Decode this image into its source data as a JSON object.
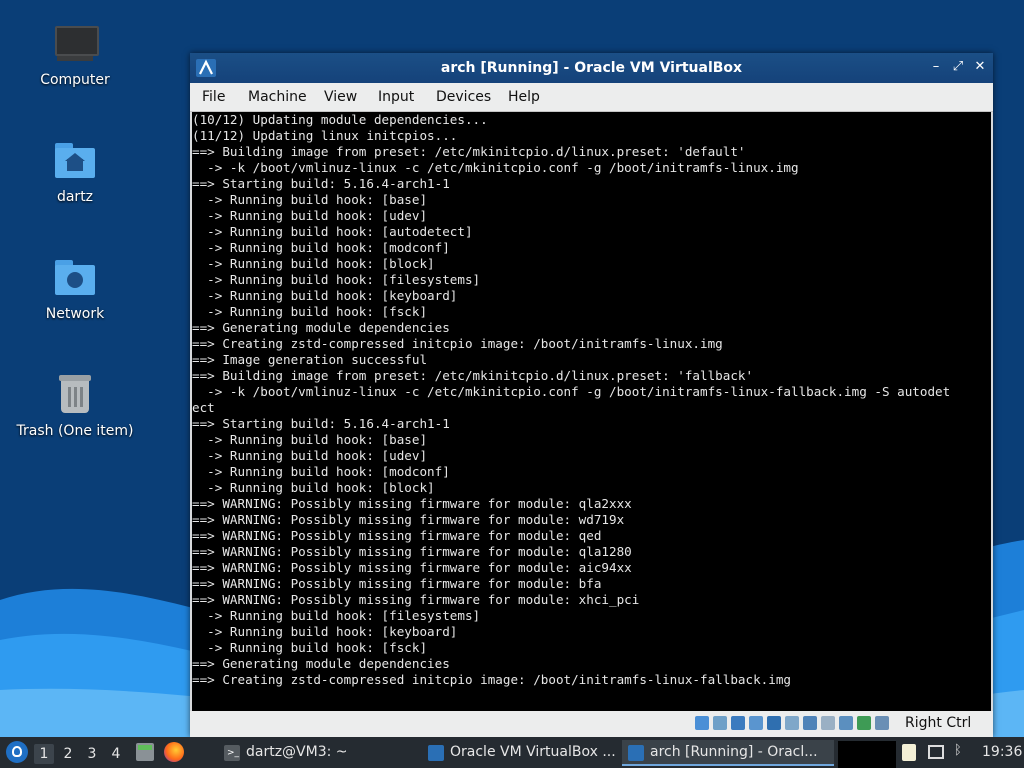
{
  "desktop": {
    "icons": [
      {
        "label": "Computer",
        "icon": "computer-icon"
      },
      {
        "label": "dartz",
        "icon": "home-folder-icon"
      },
      {
        "label": "Network",
        "icon": "network-folder-icon"
      },
      {
        "label": "Trash (One item)",
        "icon": "trash-icon"
      }
    ]
  },
  "window": {
    "title": "arch [Running] - Oracle VM VirtualBox",
    "controls": {
      "minimize": "–",
      "restore": "⤢",
      "close": "✕"
    },
    "menu": [
      "File",
      "Machine",
      "View",
      "Input",
      "Devices",
      "Help"
    ],
    "console_lines": [
      "(10/12) Updating module dependencies...",
      "(11/12) Updating linux initcpios...",
      "==> Building image from preset: /etc/mkinitcpio.d/linux.preset: 'default'",
      "  -> -k /boot/vmlinuz-linux -c /etc/mkinitcpio.conf -g /boot/initramfs-linux.img",
      "==> Starting build: 5.16.4-arch1-1",
      "  -> Running build hook: [base]",
      "  -> Running build hook: [udev]",
      "  -> Running build hook: [autodetect]",
      "  -> Running build hook: [modconf]",
      "  -> Running build hook: [block]",
      "  -> Running build hook: [filesystems]",
      "  -> Running build hook: [keyboard]",
      "  -> Running build hook: [fsck]",
      "==> Generating module dependencies",
      "==> Creating zstd-compressed initcpio image: /boot/initramfs-linux.img",
      "==> Image generation successful",
      "==> Building image from preset: /etc/mkinitcpio.d/linux.preset: 'fallback'",
      "  -> -k /boot/vmlinuz-linux -c /etc/mkinitcpio.conf -g /boot/initramfs-linux-fallback.img -S autodet",
      "ect",
      "==> Starting build: 5.16.4-arch1-1",
      "  -> Running build hook: [base]",
      "  -> Running build hook: [udev]",
      "  -> Running build hook: [modconf]",
      "  -> Running build hook: [block]",
      "==> WARNING: Possibly missing firmware for module: qla2xxx",
      "==> WARNING: Possibly missing firmware for module: wd719x",
      "==> WARNING: Possibly missing firmware for module: qed",
      "==> WARNING: Possibly missing firmware for module: qla1280",
      "==> WARNING: Possibly missing firmware for module: aic94xx",
      "==> WARNING: Possibly missing firmware for module: bfa",
      "==> WARNING: Possibly missing firmware for module: xhci_pci",
      "  -> Running build hook: [filesystems]",
      "  -> Running build hook: [keyboard]",
      "  -> Running build hook: [fsck]",
      "==> Generating module dependencies",
      "==> Creating zstd-compressed initcpio image: /boot/initramfs-linux-fallback.img"
    ],
    "status_icons": [
      "hard-disk-icon",
      "optical-drive-icon",
      "audio-icon",
      "network-icon",
      "usb-icon",
      "shared-folder-icon",
      "display-icon",
      "video-capture-icon",
      "cpu-icon",
      "mouse-integration-icon",
      "keyboard-icon"
    ],
    "host_key": "Right Ctrl"
  },
  "taskbar": {
    "workspaces": [
      "1",
      "2",
      "3",
      "4"
    ],
    "active_workspace": "1",
    "tasks": [
      {
        "label": "dartz@VM3: ~",
        "icon": "terminal-icon"
      },
      {
        "label": "Oracle VM VirtualBox ...",
        "icon": "virtualbox-icon"
      },
      {
        "label": "arch [Running] - Oracl...",
        "icon": "virtualbox-icon"
      }
    ],
    "tray_icons": [
      "clipboard-icon",
      "network-wired-icon",
      "bluetooth-icon"
    ],
    "clock": "19:36"
  },
  "colors": {
    "desktop_bg": "#0a3e77",
    "wave_light": "#2f9bf0",
    "titlebar": "#174984",
    "console_bg": "#000000",
    "taskbar_bg": "#252b31"
  }
}
